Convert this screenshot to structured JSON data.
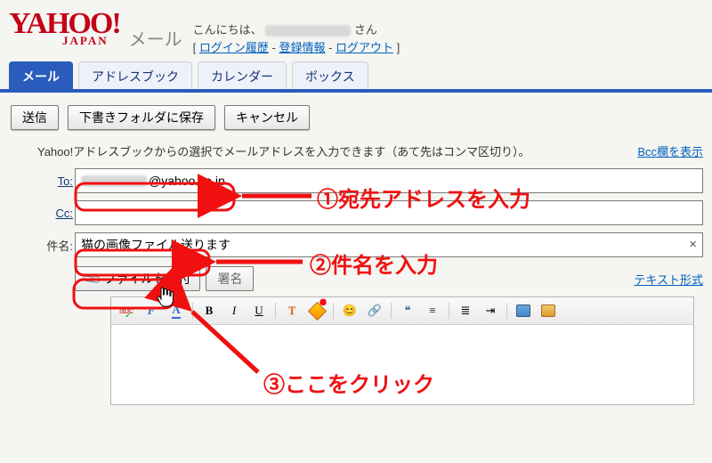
{
  "header": {
    "logo_main": "YAHOO!",
    "logo_japan": "JAPAN",
    "product": "メール",
    "greeting_prefix": "こんにちは、",
    "greeting_suffix": "さん",
    "links": {
      "login_history": "ログイン履歴",
      "reg_info": "登録情報",
      "logout": "ログアウト"
    }
  },
  "tabs": {
    "mail": "メール",
    "address": "アドレスブック",
    "calendar": "カレンダー",
    "box": "ボックス"
  },
  "actions": {
    "send": "送信",
    "save_draft": "下書きフォルダに保存",
    "cancel": "キャンセル"
  },
  "compose": {
    "hint": "Yahoo!アドレスブックからの選択でメールアドレスを入力できます（あて先はコンマ区切り）。",
    "bcc_toggle": "Bcc欄を表示",
    "to_label": "To:",
    "to_value_suffix": "@yahoo.co.jp",
    "cc_label": "Cc:",
    "cc_value": "",
    "subject_label": "件名:",
    "subject_value": "猫の画像ファイル送ります",
    "attach_label": "ファイルを添付",
    "sign_label": "署名",
    "text_mode": "テキスト形式"
  },
  "toolbar_icons": {
    "spell": "abc",
    "fontcolor": "F",
    "fontsize": "A",
    "bold": "B",
    "italic": "I",
    "underline": "U",
    "tcolor": "T",
    "highlight": "hl",
    "emoji": "😊",
    "link": "🔗",
    "quote": "❝",
    "align": "≡",
    "list": "≣",
    "indent": "⇥",
    "more": "…"
  },
  "annotations": {
    "step1": "①宛先アドレスを入力",
    "step2": "②件名を入力",
    "step3": "③ここをクリック"
  },
  "colors": {
    "red": "#f01010",
    "brand": "#c40017",
    "blue": "#2a5cbd",
    "link": "#0060c0"
  }
}
